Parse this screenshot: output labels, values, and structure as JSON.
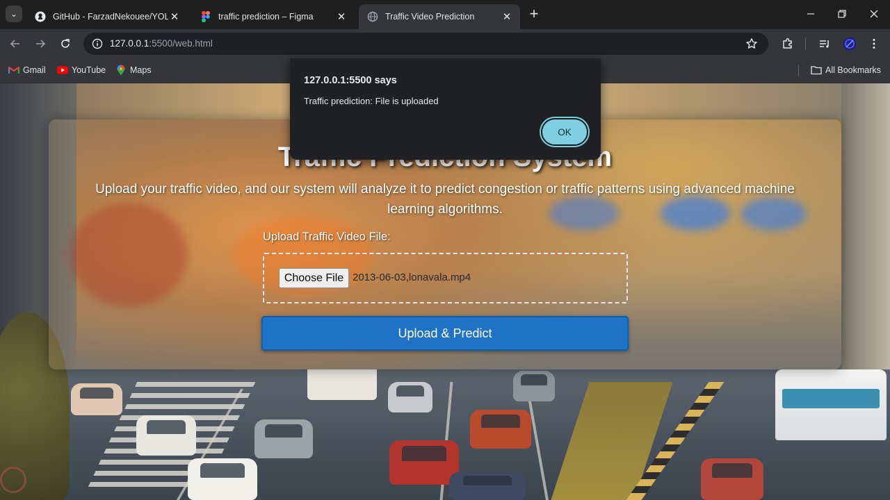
{
  "browser": {
    "tabs": [
      {
        "title": "GitHub - FarzadNekouee/YOLO",
        "favicon": "github-icon",
        "active": false
      },
      {
        "title": "traffic prediction – Figma",
        "favicon": "figma-icon",
        "active": false
      },
      {
        "title": "Traffic Video Prediction",
        "favicon": "globe-icon",
        "active": true
      }
    ],
    "url_host": "127.0.0.1",
    "url_path": ":5500/web.html",
    "bookmarks": [
      {
        "label": "Gmail",
        "icon": "gmail-icon"
      },
      {
        "label": "YouTube",
        "icon": "youtube-icon"
      },
      {
        "label": "Maps",
        "icon": "maps-icon"
      }
    ],
    "all_bookmarks": "All Bookmarks"
  },
  "page": {
    "heading": "Traffic Prediction System",
    "description": "Upload your traffic video, and our system will analyze it to predict congestion or traffic patterns using advanced machine learning algorithms.",
    "upload_label": "Upload Traffic Video File:",
    "choose_file_label": "Choose File",
    "file_name": "2013-06-03,lonavala.mp4",
    "submit_label": "Upload & Predict"
  },
  "dialog": {
    "title": "127.0.0.1:5500 says",
    "message": "Traffic prediction: File is uploaded",
    "ok_label": "OK"
  },
  "colors": {
    "primary_button": "#1f73c7",
    "dialog_ok": "#7fcfe0",
    "browser_frame": "#35363a"
  }
}
